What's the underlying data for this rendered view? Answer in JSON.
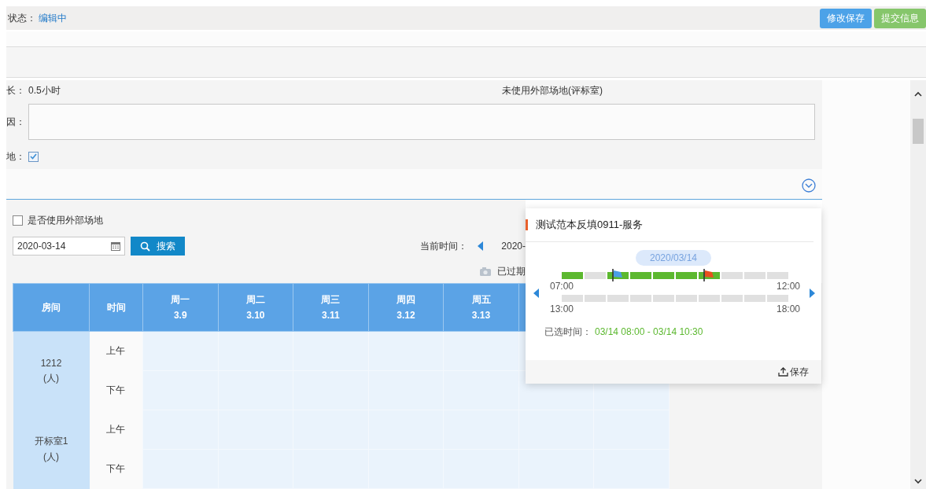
{
  "status": {
    "label": "状态：",
    "value": "编辑中"
  },
  "buttons": [
    {
      "label": "修改保存",
      "kind": "primary"
    },
    {
      "label": "提交信息",
      "kind": "success"
    }
  ],
  "form": {
    "duration": {
      "label": "长：",
      "value": "0.5小时"
    },
    "venue_note": "未使用外部场地(评标室)",
    "reason": {
      "label": "因："
    },
    "external": {
      "label": "地：",
      "checked": true
    }
  },
  "filter": {
    "use_external": {
      "label": "是否使用外部场地",
      "checked": false
    },
    "date": "2020-03-14",
    "search_button": "搜索",
    "current_time_label": "当前时间：",
    "current_time": "2020-",
    "legend": "已过期"
  },
  "table": {
    "columns": [
      {
        "kind": "plain",
        "label": "房间"
      },
      {
        "kind": "plain",
        "label": "时间"
      },
      {
        "kind": "day",
        "day": "周一",
        "date": "3.9"
      },
      {
        "kind": "day",
        "day": "周二",
        "date": "3.10"
      },
      {
        "kind": "day",
        "day": "周三",
        "date": "3.11"
      },
      {
        "kind": "day",
        "day": "周四",
        "date": "3.12"
      },
      {
        "kind": "day",
        "day": "周五",
        "date": "3.13"
      }
    ],
    "rows": [
      {
        "room": "1212",
        "unit": "(人)",
        "periods": [
          "上午",
          "下午"
        ]
      },
      {
        "room": "开标室1",
        "unit": "(人)",
        "periods": [
          "上午",
          "下午"
        ]
      }
    ]
  },
  "popup": {
    "title": "测试范本反填0911-服务",
    "date": "2020/03/14",
    "rows": [
      {
        "start": "07:00",
        "end": "12:00",
        "slots": [
          {
            "booked": true
          },
          {
            "booked": false
          },
          {
            "booked": true,
            "start_flag": true
          },
          {
            "booked": true
          },
          {
            "booked": true
          },
          {
            "booked": true
          },
          {
            "booked": true,
            "end_flag": true
          },
          {
            "booked": false
          },
          {
            "booked": false
          },
          {
            "booked": false
          }
        ]
      },
      {
        "start": "13:00",
        "end": "18:00",
        "slots": [
          {
            "booked": false
          },
          {
            "booked": false
          },
          {
            "booked": false
          },
          {
            "booked": false
          },
          {
            "booked": false
          },
          {
            "booked": false
          },
          {
            "booked": false
          },
          {
            "booked": false
          },
          {
            "booked": false
          },
          {
            "booked": false
          }
        ]
      }
    ],
    "selected_label": "已选时间：",
    "selected_value": "03/14 08:00 - 03/14 10:30",
    "save": "保存"
  }
}
